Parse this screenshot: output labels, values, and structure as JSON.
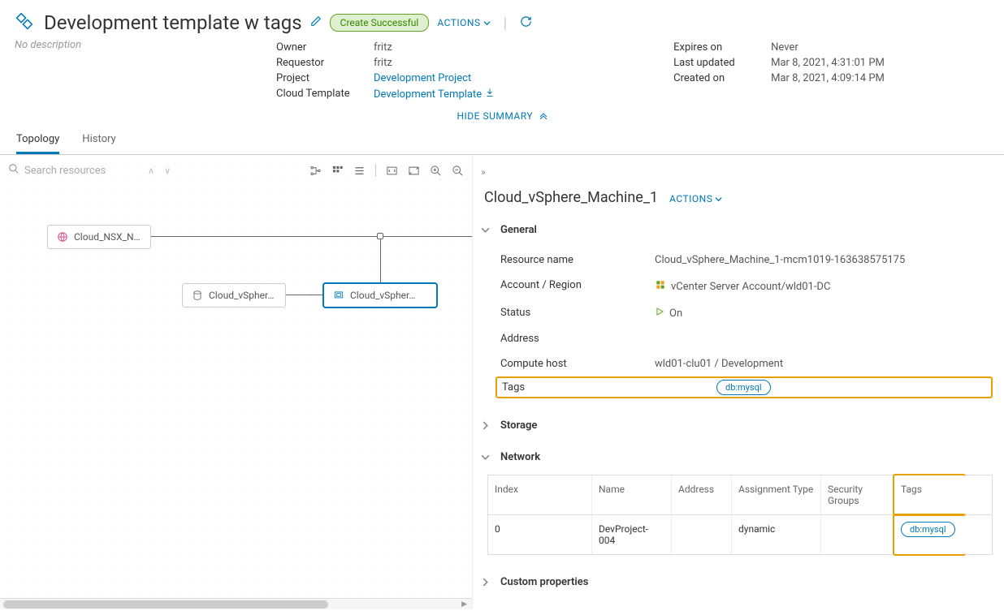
{
  "header": {
    "title": "Development template w tags",
    "subtitle": "No description",
    "status": "Create Successful",
    "actions_label": "ACTIONS"
  },
  "summary": {
    "left": {
      "owner_label": "Owner",
      "owner": "fritz",
      "requestor_label": "Requestor",
      "requestor": "fritz",
      "project_label": "Project",
      "project": "Development Project",
      "template_label": "Cloud Template",
      "template": "Development Template"
    },
    "right": {
      "expires_label": "Expires on",
      "expires": "Never",
      "updated_label": "Last updated",
      "updated": "Mar 8, 2021, 4:31:01 PM",
      "created_label": "Created on",
      "created": "Mar 8, 2021, 4:09:14 PM"
    },
    "hide_label": "HIDE SUMMARY"
  },
  "tabs": {
    "topology": "Topology",
    "history": "History"
  },
  "canvas": {
    "search_placeholder": "Search resources",
    "nodes": {
      "nsx": "Cloud_NSX_N…",
      "vsphere1": "Cloud_vSpher…",
      "vsphere2": "Cloud_vSpher…"
    }
  },
  "details": {
    "title": "Cloud_vSphere_Machine_1",
    "actions_label": "ACTIONS",
    "sections": {
      "general": "General",
      "storage": "Storage",
      "network": "Network",
      "custom": "Custom properties"
    },
    "general": {
      "resource_name_label": "Resource name",
      "resource_name": "Cloud_vSphere_Machine_1-mcm1019-163638575175",
      "account_label": "Account / Region",
      "account": "vCenter Server Account/wld01-DC",
      "status_label": "Status",
      "status": "On",
      "address_label": "Address",
      "compute_label": "Compute host",
      "compute": "wld01-clu01 / Development",
      "tags_label": "Tags",
      "tag": "db:mysql"
    },
    "network": {
      "cols": {
        "index": "Index",
        "name": "Name",
        "address": "Address",
        "atype": "Assignment Type",
        "sgrp": "Security Groups",
        "tags": "Tags"
      },
      "row": {
        "index": "0",
        "name": "DevProject-004",
        "address": "",
        "atype": "dynamic",
        "sgrp": "",
        "tag": "db:mysql"
      }
    }
  }
}
